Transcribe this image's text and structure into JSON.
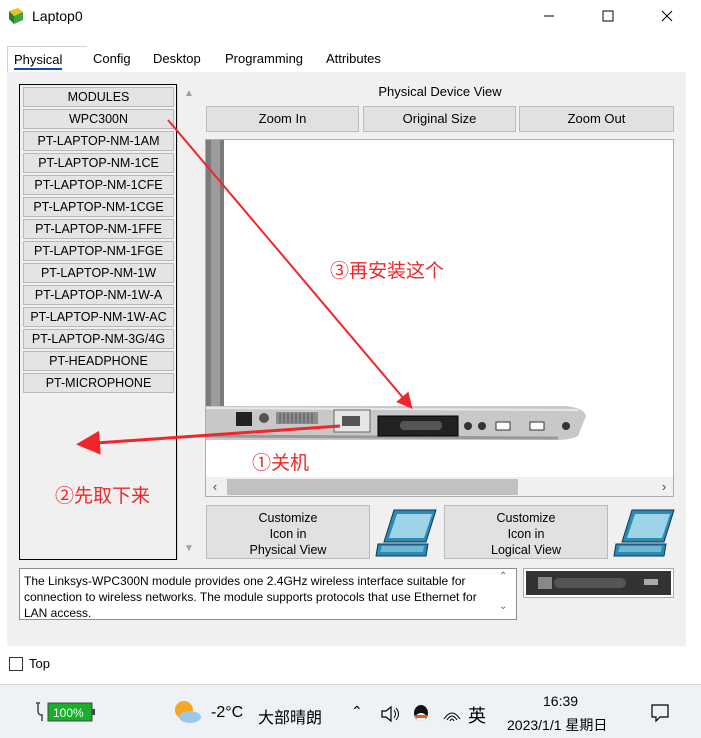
{
  "window": {
    "title": "Laptop0"
  },
  "tabs": [
    {
      "label": "Physical",
      "active": true
    },
    {
      "label": "Config"
    },
    {
      "label": "Desktop"
    },
    {
      "label": "Programming"
    },
    {
      "label": "Attributes"
    }
  ],
  "modules": [
    "MODULES",
    "WPC300N",
    "PT-LAPTOP-NM-1AM",
    "PT-LAPTOP-NM-1CE",
    "PT-LAPTOP-NM-1CFE",
    "PT-LAPTOP-NM-1CGE",
    "PT-LAPTOP-NM-1FFE",
    "PT-LAPTOP-NM-1FGE",
    "PT-LAPTOP-NM-1W",
    "PT-LAPTOP-NM-1W-A",
    "PT-LAPTOP-NM-1W-AC",
    "PT-LAPTOP-NM-3G/4G",
    "PT-HEADPHONE",
    "PT-MICROPHONE"
  ],
  "device_view": {
    "title": "Physical Device View",
    "zoom_in": "Zoom In",
    "original_size": "Original Size",
    "zoom_out": "Zoom Out"
  },
  "customize": {
    "physical": [
      "Customize",
      "Icon in",
      "Physical View"
    ],
    "logical": [
      "Customize",
      "Icon in",
      "Logical View"
    ]
  },
  "description": "The Linksys-WPC300N module provides one 2.4GHz wireless interface suitable for connection to wireless networks. The module supports protocols that use Ethernet for LAN access.",
  "top_checkbox": {
    "label": "Top",
    "checked": false
  },
  "annotations": {
    "step1": "①关机",
    "step2": "②先取下来",
    "step3": "③再安装这个",
    "color": "#f0262a"
  },
  "taskbar": {
    "battery": "100%",
    "temperature": "-2°C",
    "weather": "大部晴朗",
    "ime": "英",
    "time": "16:39",
    "date": "2023/1/1 星期日"
  },
  "colors": {
    "accent": "#0b4fa8",
    "panel": "#f0f0f0",
    "button": "#e1e1e1",
    "annotation": "#f0262a"
  }
}
